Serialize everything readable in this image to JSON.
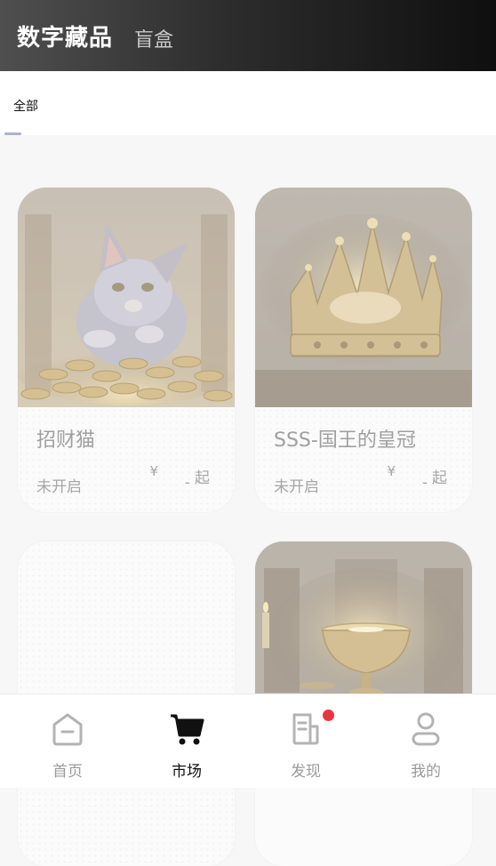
{
  "header": {
    "title": "数字藏品",
    "tab_blind_box": "盲盒"
  },
  "filter": {
    "selected": "全部"
  },
  "products": [
    {
      "name": "招财猫",
      "status": "未开启",
      "currency": "¥",
      "price": "-",
      "suffix": "起"
    },
    {
      "name": "SSS-国王的皇冠",
      "status": "未开启",
      "currency": "¥",
      "price": "-",
      "suffix": "起"
    }
  ],
  "bottom_nav": [
    {
      "label": "首页",
      "icon": "home-icon",
      "active": false
    },
    {
      "label": "市场",
      "icon": "cart-icon",
      "active": true
    },
    {
      "label": "发现",
      "icon": "document-icon",
      "active": false,
      "badge": true
    },
    {
      "label": "我的",
      "icon": "user-icon",
      "active": false
    }
  ],
  "colors": {
    "badge": "#e8363c",
    "active_tab": "#111111",
    "inactive_tab": "#9a9a9a"
  }
}
